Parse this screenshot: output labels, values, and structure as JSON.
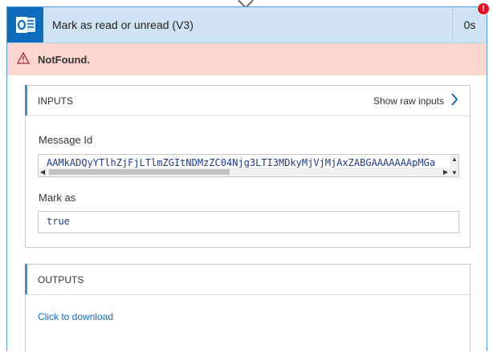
{
  "action": {
    "title": "Mark as read or unread (V3)",
    "duration": "0s",
    "error_count": "!",
    "app_icon": "outlook-icon"
  },
  "error": {
    "message": "NotFound."
  },
  "inputs": {
    "section_title": "INPUTS",
    "raw_link_label": "Show raw inputs",
    "message_id_label": "Message Id",
    "message_id_value": "AAMkADQyYTlhZjFjLTlmZGItNDMzZC04Njg3LTI3MDkyMjVjMjAxZABGAAAAAAApMGa",
    "mark_as_label": "Mark as",
    "mark_as_value": "true"
  },
  "outputs": {
    "section_title": "OUTPUTS",
    "download_label": "Click to download"
  }
}
